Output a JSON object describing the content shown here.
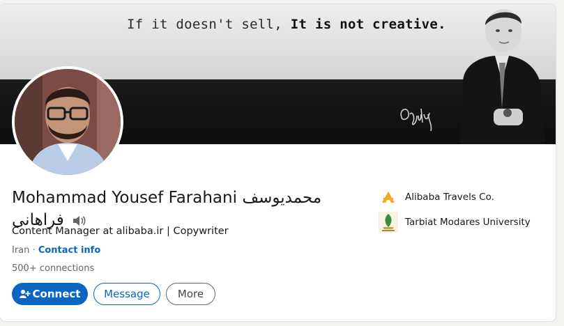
{
  "banner": {
    "quote_normal": "If it doesn't sell,",
    "quote_bold": "It is not creative.",
    "signature": "Ogilvy"
  },
  "profile": {
    "name": "Mohammad Yousef Farahani محمدیوسف فراهانی",
    "headline": "Content Manager at alibaba.ir | Copywriter",
    "location": "Iran",
    "location_separator": "·",
    "contact_info": "Contact info",
    "connections": "500+ connections"
  },
  "actions": {
    "connect": "Connect",
    "message": "Message",
    "more": "More"
  },
  "organizations": [
    {
      "name": "Alibaba Travels Co.",
      "icon": "alibaba-logo"
    },
    {
      "name": "Tarbiat Modares University",
      "icon": "university-logo"
    }
  ],
  "colors": {
    "accent": "#0a66c2",
    "page_bg": "#f3f2ef",
    "alibaba_logo": "#f5a623"
  }
}
